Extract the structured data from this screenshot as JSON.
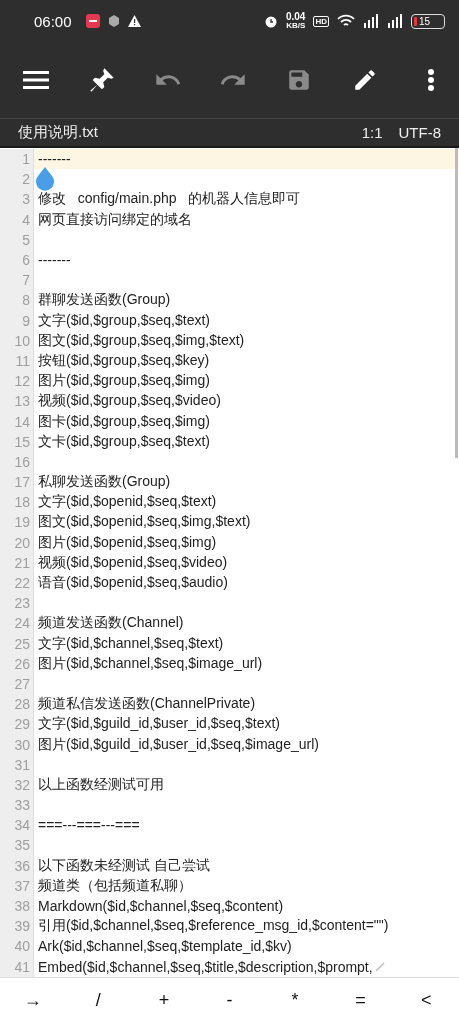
{
  "status_bar": {
    "time": "06:00",
    "net_speed": "0.04",
    "net_unit": "KB/S",
    "hd": "HD",
    "battery": "15"
  },
  "toolbar": [
    {
      "kind": "menu",
      "disabled": false
    },
    {
      "kind": "pin",
      "disabled": false
    },
    {
      "kind": "undo",
      "disabled": true
    },
    {
      "kind": "redo",
      "disabled": true
    },
    {
      "kind": "save",
      "disabled": true
    },
    {
      "kind": "edit",
      "disabled": false
    },
    {
      "kind": "more",
      "disabled": false
    }
  ],
  "file_bar": {
    "filename": "使用说明.txt",
    "position": "1:1",
    "encoding": "UTF-8"
  },
  "editor": {
    "lines": [
      {
        "number": "1",
        "text": "-------",
        "current": true
      },
      {
        "number": "2",
        "current": false
      },
      {
        "number": "3",
        "text": "修改   config/main.php   的机器人信息即可",
        "current": false
      },
      {
        "number": "4",
        "text": "网页直接访问绑定的域名",
        "current": false
      },
      {
        "number": "5",
        "current": false
      },
      {
        "number": "6",
        "text": "-------",
        "current": false
      },
      {
        "number": "7",
        "current": false
      },
      {
        "number": "8",
        "text": "群聊发送函数(Group)",
        "current": false
      },
      {
        "number": "9",
        "text": "文字($id,$group,$seq,$text)",
        "current": false
      },
      {
        "number": "10",
        "text": "图文($id,$group,$seq,$img,$text)",
        "current": false
      },
      {
        "number": "11",
        "text": "按钮($id,$group,$seq,$key)",
        "current": false
      },
      {
        "number": "12",
        "text": "图片($id,$group,$seq,$img)",
        "current": false
      },
      {
        "number": "13",
        "text": "视频($id,$group,$seq,$video)",
        "current": false
      },
      {
        "number": "14",
        "text": "图卡($id,$group,$seq,$img)",
        "current": false
      },
      {
        "number": "15",
        "text": "文卡($id,$group,$seq,$text)",
        "current": false
      },
      {
        "number": "16",
        "current": false
      },
      {
        "number": "17",
        "text": "私聊发送函数(Group)",
        "current": false
      },
      {
        "number": "18",
        "text": "文字($id,$openid,$seq,$text)",
        "current": false
      },
      {
        "number": "19",
        "text": "图文($id,$openid,$seq,$img,$text)",
        "current": false
      },
      {
        "number": "20",
        "text": "图片($id,$openid,$seq,$img)",
        "current": false
      },
      {
        "number": "21",
        "text": "视频($id,$openid,$seq,$video)",
        "current": false
      },
      {
        "number": "22",
        "text": "语音($id,$openid,$seq,$audio)",
        "current": false
      },
      {
        "number": "23",
        "current": false
      },
      {
        "number": "24",
        "text": "频道发送函数(Channel)",
        "current": false
      },
      {
        "number": "25",
        "text": "文字($id,$channel,$seq,$text)",
        "current": false
      },
      {
        "number": "26",
        "text": "图片($id,$channel,$seq,$image_url)",
        "current": false
      },
      {
        "number": "27",
        "current": false
      },
      {
        "number": "28",
        "text": "频道私信发送函数(ChannelPrivate)",
        "current": false
      },
      {
        "number": "29",
        "text": "文字($id,$guild_id,$user_id,$seq,$text)",
        "current": false
      },
      {
        "number": "30",
        "text": "图片($id,$guild_id,$user_id,$seq,$image_url)",
        "current": false
      },
      {
        "number": "31",
        "current": false
      },
      {
        "number": "32",
        "text": "以上函数经测试可用",
        "current": false
      },
      {
        "number": "33",
        "current": false
      },
      {
        "number": "34",
        "text": "===---===---===",
        "current": false
      },
      {
        "number": "35",
        "current": false
      },
      {
        "number": "36",
        "text": "以下函数未经测试 自己尝试",
        "current": false
      },
      {
        "number": "37",
        "text": "频道类（包括频道私聊）",
        "current": false
      },
      {
        "number": "38",
        "text": "Markdown($id,$channel,$seq,$content)",
        "current": false
      },
      {
        "number": "39",
        "text": "引用($id,$channel,$seq,$reference_msg_id,$content=\"\")",
        "current": false
      },
      {
        "number": "40",
        "text": "Ark($id,$channel,$seq,$template_id,$kv)",
        "current": false
      },
      {
        "number": "41",
        "text": "Embed($id,$channel,$seq,$title,$description,$prompt,",
        "current": false,
        "wrapped": true
      }
    ]
  },
  "symbol_keys": [
    "→",
    "/",
    "+",
    "-",
    "*",
    "=",
    "<"
  ]
}
